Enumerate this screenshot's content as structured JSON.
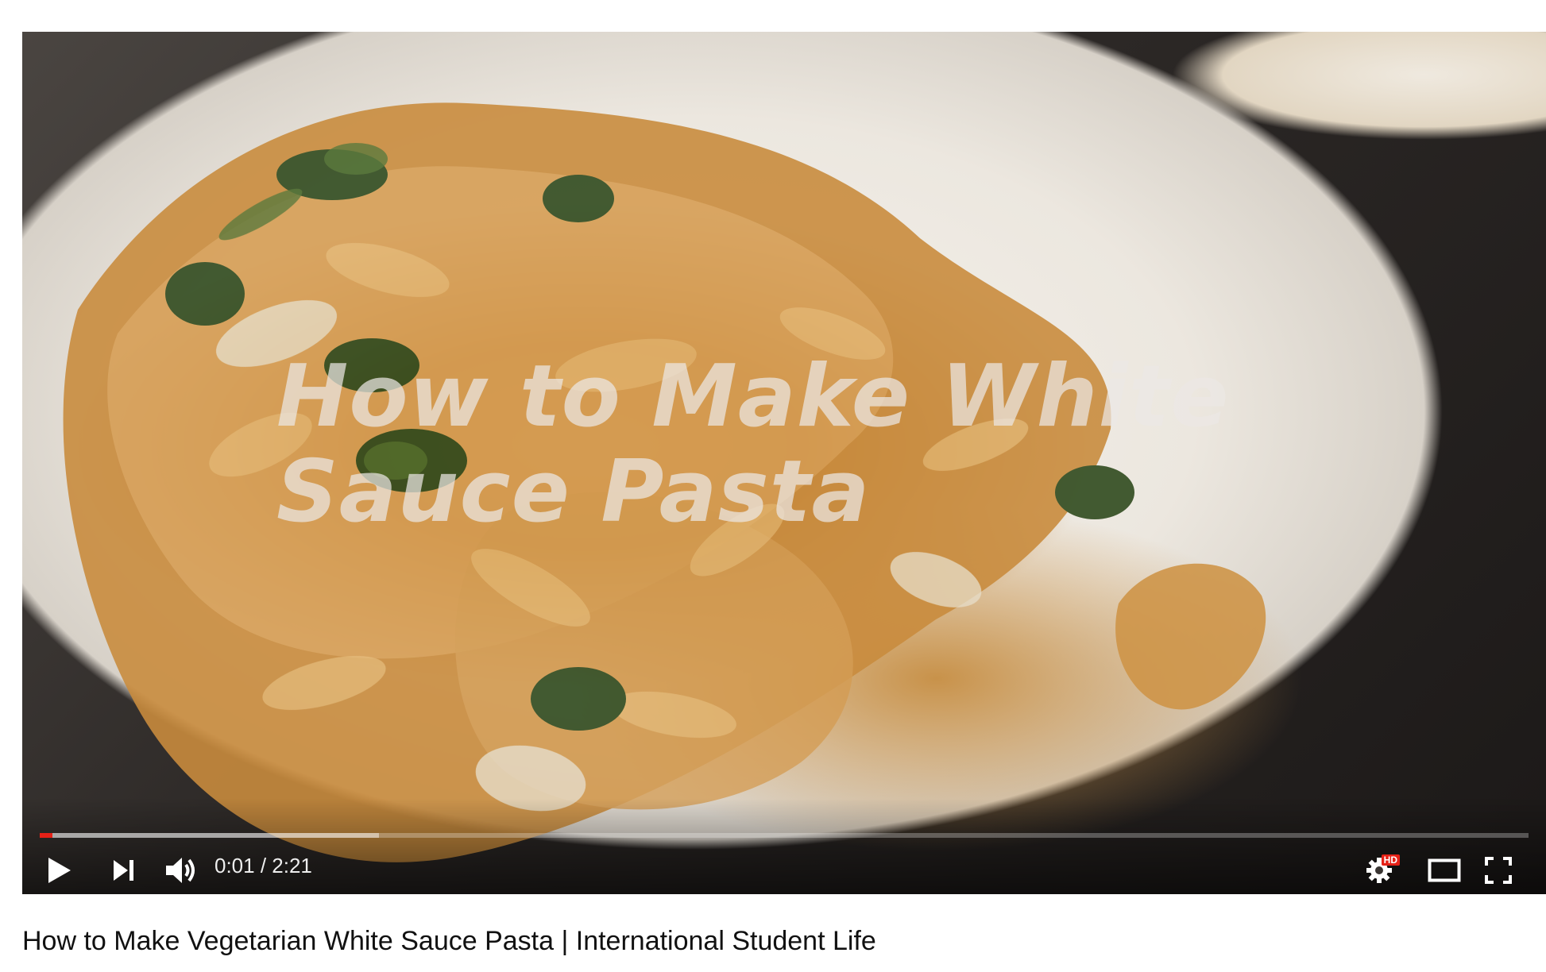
{
  "player": {
    "overlay_title": "How to Make White Sauce Pasta",
    "time_display": "0:01 / 2:21",
    "progress": {
      "played_fraction": 0.0083,
      "buffered_fraction": 0.228
    },
    "quality_badge": "HD",
    "controls": {
      "play_icon": "play-icon",
      "next_icon": "next-icon",
      "volume_icon": "volume-icon",
      "settings_icon": "gear-icon",
      "theater_icon": "theater-mode-icon",
      "fullscreen_icon": "fullscreen-icon"
    },
    "colors": {
      "progress_played": "#e62117",
      "control_icons": "#ffffff"
    }
  },
  "video": {
    "title": "How to Make Vegetarian White Sauce Pasta | International Student Life"
  }
}
